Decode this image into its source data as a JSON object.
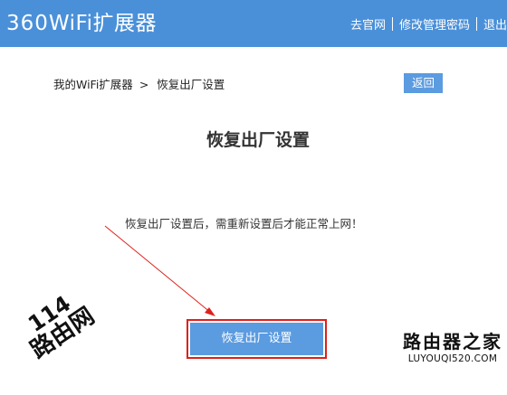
{
  "app": {
    "brand_number": "360",
    "brand_text": "WiFi扩展器"
  },
  "header": {
    "links": [
      "去官网",
      "修改管理密码",
      "退出"
    ]
  },
  "breadcrumb": {
    "parent": "我的WiFi扩展器",
    "separator": ">",
    "current": "恢复出厂设置"
  },
  "back_button": "返回",
  "page_title": "恢复出厂设置",
  "notice": "恢复出厂设置后，需重新设置后才能正常上网！",
  "reset_button": "恢复出厂设置",
  "watermarks": {
    "left_line1": "114",
    "left_line2": "路由网",
    "right_title": "路由器之家",
    "right_url": "LUYOUQI520.COM"
  },
  "colors": {
    "header_bg": "#4a90d9",
    "button_bg": "#5b9be0",
    "annotation_red": "#e0201a"
  }
}
